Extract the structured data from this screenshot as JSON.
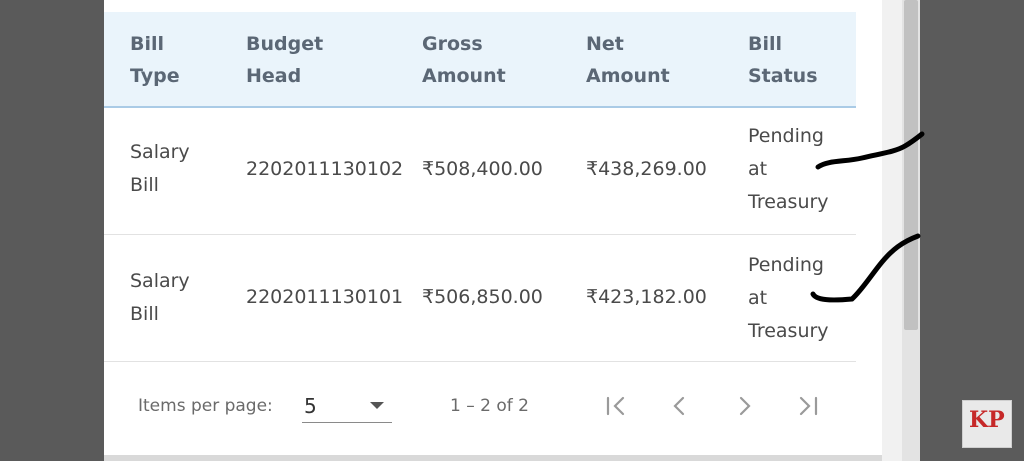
{
  "table": {
    "headers": [
      "Bill\nType",
      "Budget\nHead",
      "Gross\nAmount",
      "Net\nAmount",
      "Bill\nStatus"
    ],
    "rows": [
      [
        "Salary\nBill",
        "2202011130102",
        "₹508,400.00",
        "₹438,269.00",
        "Pending\nat\nTreasury"
      ],
      [
        "Salary\nBill",
        "2202011130101",
        "₹506,850.00",
        "₹423,182.00",
        "Pending\nat\nTreasury"
      ]
    ]
  },
  "paginator": {
    "items_per_page_label": "Items per page:",
    "page_size": "5",
    "range_label": "1 – 2 of 2",
    "icons": [
      "first-page-icon",
      "previous-page-icon",
      "next-page-icon",
      "last-page-icon"
    ]
  },
  "logo": {
    "text_k": "K",
    "text_p": "P",
    "subtitle": ""
  }
}
